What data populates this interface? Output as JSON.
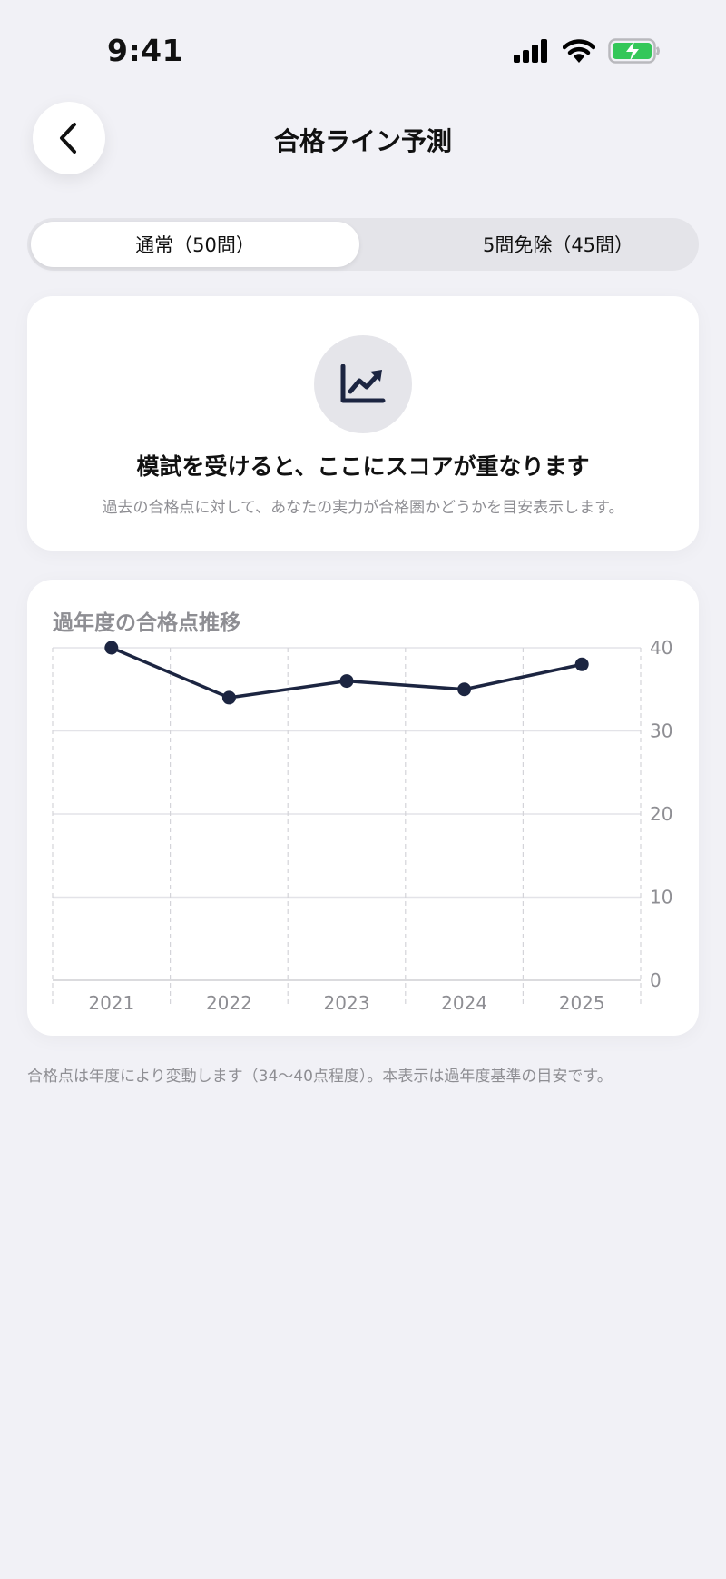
{
  "status_bar": {
    "time": "9:41"
  },
  "nav": {
    "title": "合格ライン予測",
    "back_icon": "chevron-left-icon"
  },
  "segmented_control": {
    "options": [
      {
        "label": "通常（50問）",
        "selected": true
      },
      {
        "label": "5問免除（45問）",
        "selected": false
      }
    ]
  },
  "empty_state": {
    "icon": "trending-chart-icon",
    "title": "模試を受けると、ここにスコアが重なります",
    "description": "過去の合格点に対して、あなたの実力が合格圏かどうかを目安表示します。"
  },
  "chart_data": {
    "type": "line",
    "title": "過年度の合格点推移",
    "categories": [
      "2021",
      "2022",
      "2023",
      "2024",
      "2025"
    ],
    "values": [
      40,
      34,
      36,
      35,
      38
    ],
    "yticks": [
      0,
      10,
      20,
      30,
      40
    ],
    "ylim": [
      0,
      40
    ],
    "y_axis_side": "right",
    "line_color": "#1c2541",
    "grid": true
  },
  "footnote": "合格点は年度により変動します（34〜40点程度）。本表示は過年度基準の目安です。",
  "colors": {
    "background": "#f1f1f6",
    "accent_navy": "#1c2541",
    "battery_green": "#34c759",
    "muted_text": "#8e8e93"
  }
}
